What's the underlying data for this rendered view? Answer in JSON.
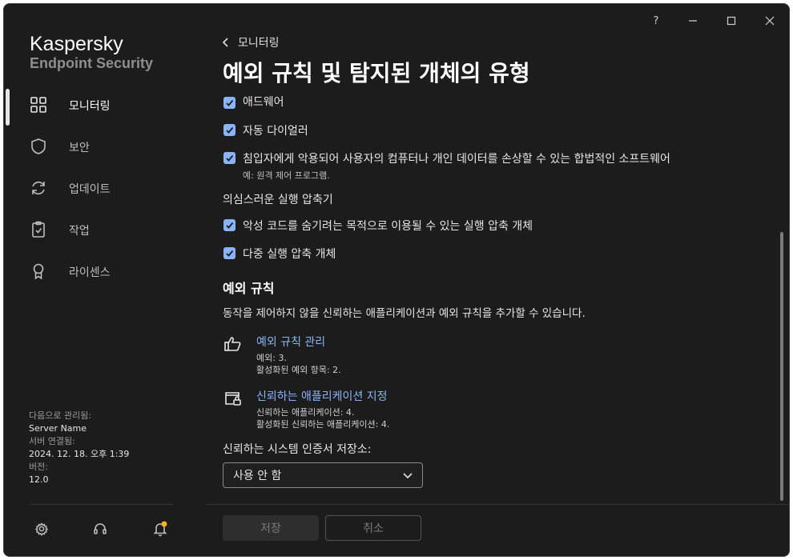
{
  "window_controls": {
    "help": "?"
  },
  "brand": {
    "name": "Kaspersky",
    "product": "Endpoint Security"
  },
  "sidebar": {
    "items": [
      {
        "label": "모니터링",
        "icon": "dashboard-icon",
        "active": true
      },
      {
        "label": "보안",
        "icon": "shield-icon",
        "active": false
      },
      {
        "label": "업데이트",
        "icon": "refresh-icon",
        "active": false
      },
      {
        "label": "작업",
        "icon": "clipboard-icon",
        "active": false
      },
      {
        "label": "라이센스",
        "icon": "license-icon",
        "active": false
      }
    ],
    "managed": {
      "by_label": "다음으로 관리됨:",
      "by_value": "Server Name",
      "conn_label": "서버 연결됨:",
      "conn_value": "2024. 12. 18. 오후 1:39",
      "version_label": "버전:",
      "version_value": "12.0"
    }
  },
  "header": {
    "back_label": "모니터링",
    "title": "예외 규칙 및 탐지된 개체의 유형"
  },
  "content": {
    "checkboxes": [
      {
        "label": "애드웨어",
        "checked": true
      },
      {
        "label": "자동 다이얼러",
        "checked": true
      },
      {
        "label": "침입자에게 악용되어 사용자의 컴퓨터나 개인 데이터를 손상할 수 있는 합법적인 소프트웨어",
        "sub": "예: 원격 제어 프로그램.",
        "checked": true
      }
    ],
    "packers_heading": "의심스러운 실행 압축기",
    "packers": [
      {
        "label": "악성 코드를 숨기려는 목적으로 이용될 수 있는 실행 압축 개체",
        "checked": true
      },
      {
        "label": "다중 실행 압축 개체",
        "checked": true
      }
    ],
    "exclusions_heading": "예외 규칙",
    "exclusions_desc": "동작을 제어하지 않을 신뢰하는 애플리케이션과 예외 규칙을 추가할 수 있습니다.",
    "manage_link": {
      "label": "예외 규칙 관리",
      "line1": "예외: 3.",
      "line2": "활성화된 예외 항목: 2."
    },
    "trusted_link": {
      "label": "신뢰하는 애플리케이션 지정",
      "line1": "신뢰하는 애플리케이션: 4.",
      "line2": "활성화된 신뢰하는 애플리케이션: 4."
    },
    "cert_store_label": "신뢰하는 시스템 인증서 저장소:",
    "cert_store_value": "사용 안 함"
  },
  "footer": {
    "save_label": "저장",
    "cancel_label": "취소"
  },
  "colors": {
    "background": "#1c1c1c",
    "accent": "#8ab4f8",
    "notification_dot": "#f5b324"
  }
}
